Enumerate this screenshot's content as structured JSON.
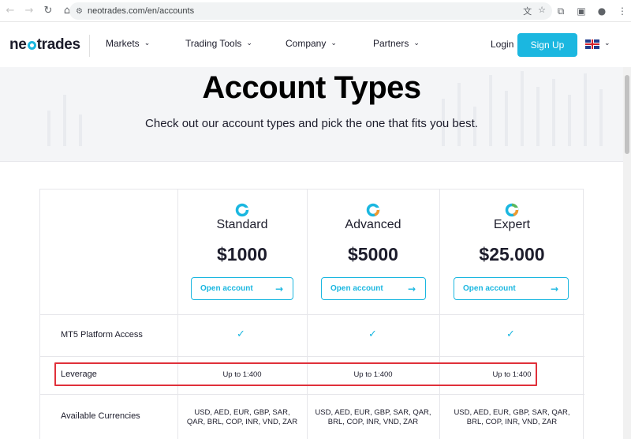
{
  "browser": {
    "url": "neotrades.com/en/accounts",
    "back_icon": "arrow-left-icon",
    "forward_icon": "arrow-right-icon",
    "reload_icon": "reload-icon",
    "home_icon": "home-icon"
  },
  "header": {
    "logo_text_a": "ne",
    "logo_text_b": "trades",
    "menu": [
      {
        "label": "Markets"
      },
      {
        "label": "Trading Tools"
      },
      {
        "label": "Company"
      },
      {
        "label": "Partners"
      }
    ],
    "login_label": "Login",
    "signup_label": "Sign Up"
  },
  "hero": {
    "title": "Account Types",
    "subtitle": "Check out our account types and pick the one that fits you best."
  },
  "accounts": [
    {
      "name": "Standard",
      "price": "$1000",
      "button": "Open account",
      "logo_color": "#1bb7e0"
    },
    {
      "name": "Advanced",
      "price": "$5000",
      "button": "Open account",
      "logo_color": "#f39a2b"
    },
    {
      "name": "Expert",
      "price": "$25.000",
      "button": "Open account",
      "logo_color": "#5cb85c"
    }
  ],
  "rows": {
    "platform": {
      "label": "MT5 Platform Access"
    },
    "leverage": {
      "label": "Leverage",
      "values": [
        "Up to 1:400",
        "Up to 1:400",
        "Up to 1:400"
      ]
    },
    "currencies": {
      "label": "Available Currencies",
      "line1": "USD, AED, EUR, GBP, SAR, QAR,",
      "line1_first": "USD, AED, EUR, GBP, SAR,",
      "line2_first": "QAR, BRL, COP, INR, VND, ZAR",
      "line2": "BRL, COP, INR, VND, ZAR"
    }
  },
  "colors": {
    "accent": "#1bb7e0",
    "highlight": "#e0303a"
  }
}
